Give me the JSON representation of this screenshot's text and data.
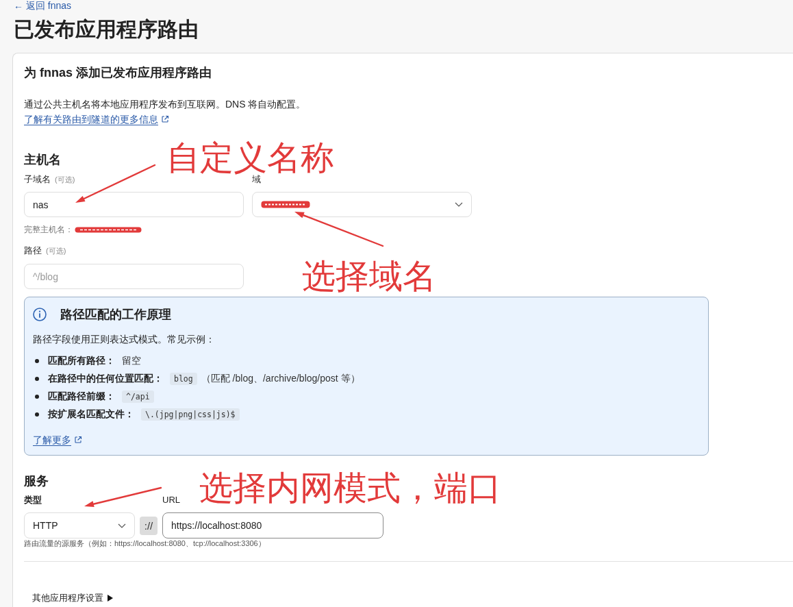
{
  "back_link": "← 返回 fnnas",
  "page_title": "已发布应用程序路由",
  "card": {
    "title": "为 fnnas 添加已发布应用程序路由",
    "description": "通过公共主机名将本地应用程序发布到互联网。DNS 将自动配置。",
    "learn_more_link": "了解有关路由到隧道的更多信息",
    "hostname": {
      "heading": "主机名",
      "subdomain": {
        "label": "子域名",
        "hint": "(可选)",
        "value": "nas"
      },
      "domain": {
        "label": "域",
        "redacted": true
      },
      "full_hostname": {
        "label": "完整主机名：",
        "redacted": true
      },
      "path": {
        "label": "路径",
        "hint": "(可选)",
        "placeholder": "^/blog"
      }
    },
    "path_help": {
      "title": "路径匹配的工作原理",
      "intro": "路径字段使用正则表达式模式。常见示例：",
      "examples": [
        {
          "label": "匹配所有路径：",
          "kind": "text",
          "value": "留空"
        },
        {
          "label": "在路径中的任何位置匹配：",
          "kind": "code",
          "value": "blog",
          "note": "（匹配 /blog、/archive/blog/post 等）"
        },
        {
          "label": "匹配路径前缀：",
          "kind": "code",
          "value": "^/api"
        },
        {
          "label": "按扩展名匹配文件：",
          "kind": "code",
          "value": "\\.(jpg|png|css|js)$"
        }
      ],
      "link": "了解更多"
    },
    "service": {
      "heading": "服务",
      "type": {
        "label": "类型",
        "value": "HTTP"
      },
      "separator": "://",
      "url": {
        "label": "URL",
        "value": "https://localhost:8080",
        "focused": true
      },
      "hint": "路由流量的源服务（例如：https://localhost:8080、tcp://localhost:3306）"
    },
    "additional_settings": {
      "label": "其他应用程序设置",
      "expanded": false
    }
  },
  "annotations": [
    {
      "text": "自定义名称"
    },
    {
      "text": "选择域名"
    },
    {
      "text": "选择内网模式，端口"
    }
  ]
}
